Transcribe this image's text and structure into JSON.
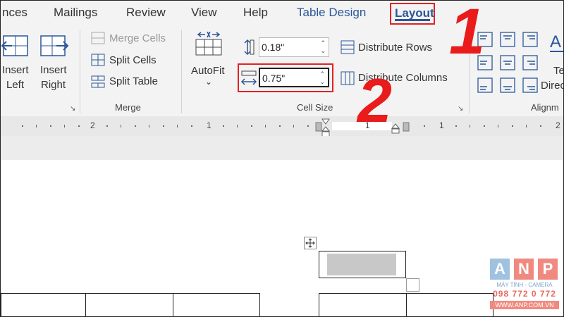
{
  "tabs": [
    {
      "label": "nces"
    },
    {
      "label": "Mailings"
    },
    {
      "label": "Review"
    },
    {
      "label": "View"
    },
    {
      "label": "Help"
    },
    {
      "label": "Table Design"
    },
    {
      "label": "Layout"
    }
  ],
  "ribbon": {
    "insert_left": {
      "line1": "Insert",
      "line2": "Left"
    },
    "insert_right": {
      "line1": "Insert",
      "line2": "Right"
    },
    "merge_cells": "Merge Cells",
    "split_cells": "Split Cells",
    "split_table": "Split Table",
    "merge_group": "Merge",
    "autofit": "AutoFit",
    "row_height": "0.18\"",
    "column_width": "0.75\"",
    "distribute_rows": "Distribute Rows",
    "distribute_columns": "Distribute Columns",
    "cell_size_group": "Cell Size",
    "text_direction": {
      "line1": "Te",
      "line2": "Direc"
    },
    "alignment_group": "Alignm"
  },
  "annotations": {
    "step1": "1",
    "step2": "2"
  },
  "ruler": {
    "labels": [
      "2",
      "1",
      "1",
      "1",
      "2"
    ]
  },
  "watermark": {
    "letters": [
      "A",
      "N",
      "P"
    ],
    "tagline": "MÁY TÍNH - CAMERA",
    "phone": "098 772 0 772",
    "site": "WWW.ANP.COM.VN"
  },
  "colors": {
    "accent": "#2b579a",
    "annotation": "#e32222",
    "ribbon_bg": "#f3f3f3"
  }
}
